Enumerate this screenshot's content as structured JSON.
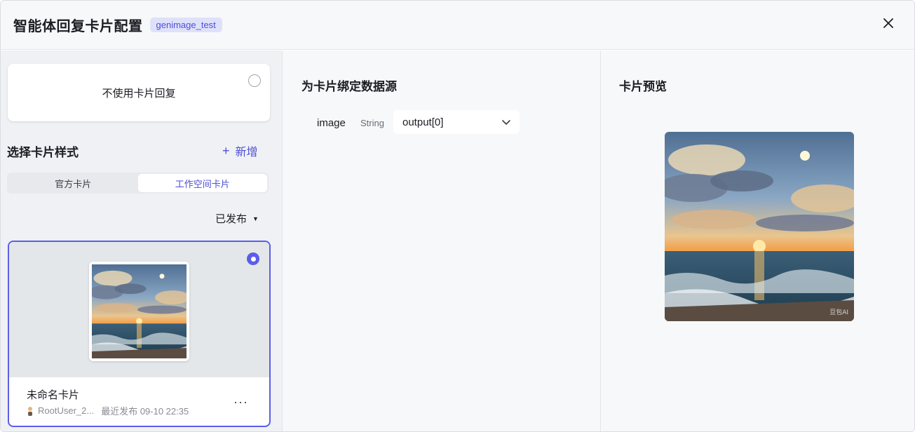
{
  "header": {
    "title": "智能体回复卡片配置",
    "tag": "genimage_test"
  },
  "left": {
    "no_card_label": "不使用卡片回复",
    "section_title": "选择卡片样式",
    "add_label": "新增",
    "tabs": [
      {
        "label": "官方卡片",
        "active": false
      },
      {
        "label": "工作空间卡片",
        "active": true
      }
    ],
    "filter_label": "已发布",
    "card": {
      "name": "未命名卡片",
      "owner": "RootUser_2...",
      "published": "最近发布 09-10 22:35",
      "selected": true
    }
  },
  "middle": {
    "title": "为卡片绑定数据源",
    "field": {
      "name": "image",
      "type": "String",
      "value": "output[0]"
    }
  },
  "right": {
    "title": "卡片预览",
    "watermark": "豆包AI"
  },
  "colors": {
    "accent": "#4c4fd6",
    "selected_border": "#5b5ee8",
    "tag_bg": "#dfe1fb"
  }
}
